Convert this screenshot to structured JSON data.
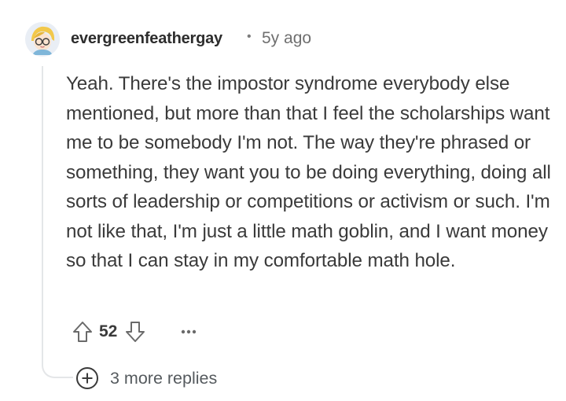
{
  "comment": {
    "username": "evergreenfeathergay",
    "separator": "•",
    "timestamp": "5y ago",
    "body": "Yeah. There's the impostor syndrome everybody else mentioned, but more than that I feel the scholarships want me to be somebody I'm not. The way they're phrased or something, they want you to be doing everything, doing all sorts of leadership or competitions or activism or such. I'm not like that, I'm just a little math goblin, and I want money so that I can stay in my comfortable math hole.",
    "avatar_icon": "user-avatar-icon"
  },
  "actions": {
    "upvote_icon": "arrow-up-icon",
    "score": "52",
    "downvote_icon": "arrow-down-icon",
    "more_icon": "more-dots-icon"
  },
  "replies": {
    "expand_icon": "plus-circle-icon",
    "label": "3 more replies"
  },
  "colors": {
    "text": "#3a3a3a",
    "meta": "#6f6f6f",
    "thread_line": "#e4e6e8"
  }
}
